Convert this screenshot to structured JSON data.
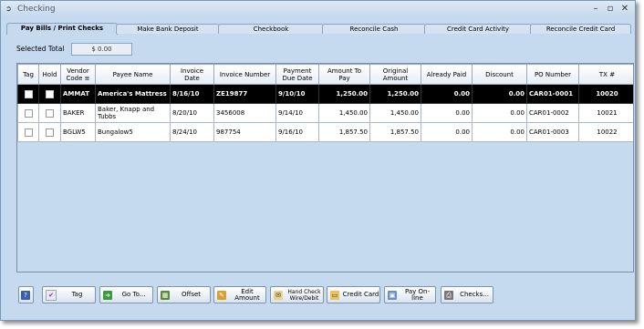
{
  "window": {
    "title": "Checking",
    "minimize": "–",
    "maximize": "▫",
    "close": "✕"
  },
  "tabs": [
    {
      "label": "Pay Bills / Print Checks"
    },
    {
      "label": "Make Bank Deposit"
    },
    {
      "label": "Checkbook"
    },
    {
      "label": "Reconcile Cash"
    },
    {
      "label": "Credit Card Activity"
    },
    {
      "label": "Reconcile Credit Card"
    }
  ],
  "selected_total": {
    "label": "Selected Total",
    "value": "$ 0.00"
  },
  "columns": {
    "tag": "Tag",
    "hold": "Hold",
    "vendor_code": "Vendor Code ≡",
    "payee_name": "Payee Name",
    "invoice_date": "Invoice Date",
    "invoice_number": "Invoice Number",
    "payment_due_date": "Payment Due Date",
    "amount_to_pay": "Amount To Pay",
    "original_amount": "Original Amount",
    "already_paid": "Already Paid",
    "discount": "Discount",
    "po_number": "PO Number",
    "tx": "TX #"
  },
  "rows": [
    {
      "vendor": "AMMAT",
      "payee": "America's Mattress",
      "inv_date": "8/16/10",
      "inv_no": "ZE19877",
      "due": "9/10/10",
      "to_pay": "1,250.00",
      "orig": "1,250.00",
      "paid": "0.00",
      "disc": "0.00",
      "po": "CAR01-0001",
      "tx": "10020"
    },
    {
      "vendor": "BAKER",
      "payee": "Baker, Knapp and Tubbs",
      "inv_date": "8/20/10",
      "inv_no": "3456008",
      "due": "9/14/10",
      "to_pay": "1,450.00",
      "orig": "1,450.00",
      "paid": "0.00",
      "disc": "0.00",
      "po": "CAR01-0002",
      "tx": "10021"
    },
    {
      "vendor": "BGLW5",
      "payee": "Bungalow5",
      "inv_date": "8/24/10",
      "inv_no": "987754",
      "due": "9/16/10",
      "to_pay": "1,857.50",
      "orig": "1,857.50",
      "paid": "0.00",
      "disc": "0.00",
      "po": "CAR01-0003",
      "tx": "10022"
    }
  ],
  "buttons": {
    "help": "?",
    "tag": "Tag",
    "goto": "Go To...",
    "offset": "Offset",
    "edit_amount": "Edit Amount",
    "hand_check": "Hand Check Wire/Debit",
    "credit_card": "Credit Card",
    "pay_online": "Pay On-line",
    "checks": "Checks..."
  },
  "colors": {
    "window_bg": "#c5d9ef",
    "selected_row": "#000000"
  }
}
